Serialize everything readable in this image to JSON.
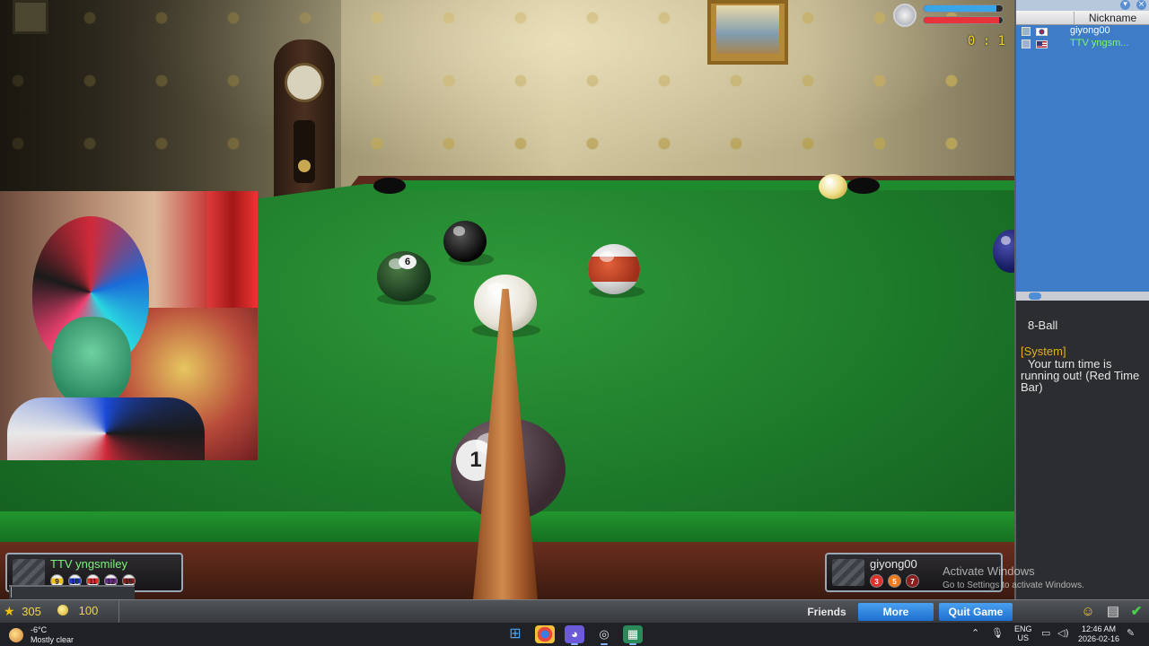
{
  "hud": {
    "score": "0 : 1",
    "timer_bar_colors": [
      "#3aa4e8",
      "#e8333a"
    ]
  },
  "table": {
    "felt_color": "#1d7a2a",
    "rail_color": "#5b2a1c",
    "visible_ball_numbers": [
      "8",
      "6",
      "1"
    ]
  },
  "player_left": {
    "name": "TTV  yngsmiley",
    "name_color": "#7cf37c",
    "balls": [
      "9",
      "10",
      "11",
      "12",
      "15"
    ]
  },
  "player_right": {
    "name": "giyong00",
    "name_color": "#e6e6e6",
    "balls": [
      "3",
      "5",
      "7"
    ]
  },
  "watermark": {
    "line1": "Activate Windows",
    "line2": "Go to Settings to activate Windows."
  },
  "side_panel": {
    "column_header": "Nickname",
    "players": [
      {
        "flag": "kr",
        "name": "giyong00",
        "color": "#ffffff"
      },
      {
        "flag": "us",
        "name": "TTV yngsm...",
        "color": "#7cf37c"
      }
    ],
    "chat": {
      "room": "8-Ball",
      "system_tag": "[System]",
      "message": "Your turn time is running out! (Red Time Bar)"
    }
  },
  "bottom_bar": {
    "stars": "305",
    "coins": "100",
    "friends_label": "Friends",
    "more_label": "More",
    "quit_label": "Quit Game"
  },
  "taskbar": {
    "temperature": "-6°C",
    "condition": "Mostly clear",
    "lang_line1": "ENG",
    "lang_line2": "US",
    "time": "12:46 AM",
    "date": "2026-02-16"
  }
}
